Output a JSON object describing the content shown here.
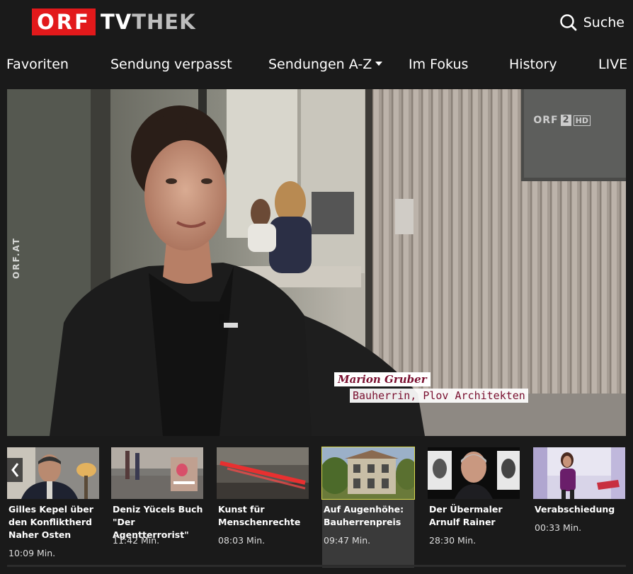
{
  "header": {
    "logo_orf": "ORF",
    "logo_tv": "TV",
    "logo_thek": "THEK",
    "search_label": "Suche"
  },
  "nav": {
    "items": [
      {
        "label": "Favoriten"
      },
      {
        "label": "Sendung verpasst"
      },
      {
        "label": "Sendungen A-Z",
        "dropdown": true
      },
      {
        "label": "Im Fokus"
      },
      {
        "label": "History"
      },
      {
        "label": "LIVE"
      }
    ]
  },
  "player": {
    "channel_bug_orf": "ORF",
    "channel_bug_num": "2",
    "channel_bug_hd": "HD",
    "watermark": "ORF.AT",
    "caption_name": "Marion Gruber",
    "caption_role": "Bauherrin, Plov Architekten"
  },
  "teasers": [
    {
      "title": "Gilles Kepel über den Konfliktherd Naher Osten",
      "duration": "10:09 Min."
    },
    {
      "title": "Deniz Yücels Buch \"Der Agentterrorist\"",
      "duration": "11:42 Min."
    },
    {
      "title": "Kunst für Menschenrechte",
      "duration": "08:03 Min."
    },
    {
      "title": "Auf Augenhöhe: Bauherrenpreis",
      "duration": "09:47 Min.",
      "active": true
    },
    {
      "title": "Der Übermaler Arnulf Rainer",
      "duration": "28:30 Min."
    },
    {
      "title": "Verabschiedung",
      "duration": "00:33 Min."
    }
  ],
  "colors": {
    "brand_red": "#e2191b",
    "background": "#1a1a1a",
    "active_card": "#3a3a3a",
    "caption_text": "#7a1030"
  },
  "icons": {
    "search": "magnifier",
    "carousel_prev": "chevron-left"
  }
}
